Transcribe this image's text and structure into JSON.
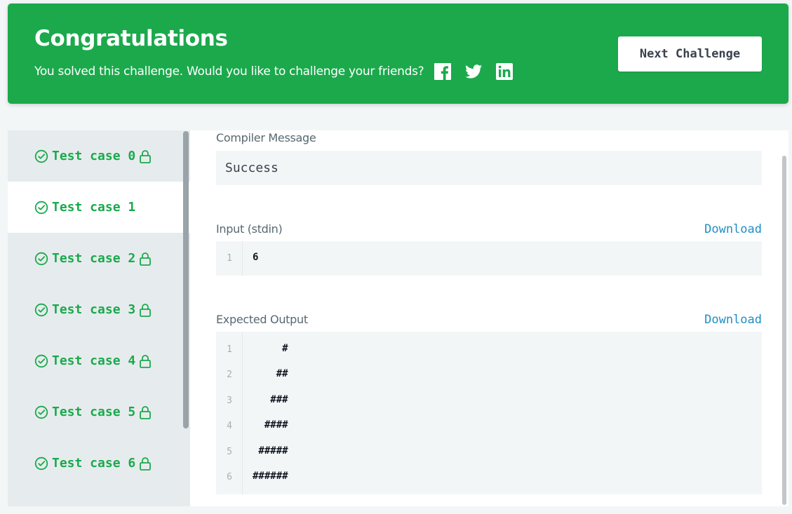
{
  "banner": {
    "title": "Congratulations",
    "message": "You solved this challenge. Would you like to challenge your friends?",
    "social_icons": [
      "facebook-icon",
      "twitter-icon",
      "linkedin-icon"
    ],
    "next_button": "Next Challenge",
    "color": "#1ba94c"
  },
  "sidebar": {
    "test_cases": [
      {
        "label": "Test case 0",
        "locked": true
      },
      {
        "label": "Test case 1",
        "locked": false
      },
      {
        "label": "Test case 2",
        "locked": true
      },
      {
        "label": "Test case 3",
        "locked": true
      },
      {
        "label": "Test case 4",
        "locked": true
      },
      {
        "label": "Test case 5",
        "locked": true
      },
      {
        "label": "Test case 6",
        "locked": true
      }
    ],
    "selected_index": 1
  },
  "compiler": {
    "label": "Compiler Message",
    "message": "Success"
  },
  "input": {
    "label": "Input (stdin)",
    "download": "Download",
    "line_numbers": [
      "1"
    ],
    "lines": [
      "6"
    ]
  },
  "expected": {
    "label": "Expected Output",
    "download": "Download",
    "line_numbers": [
      "1",
      "2",
      "3",
      "4",
      "5",
      "6"
    ],
    "lines": [
      "     #",
      "    ##",
      "   ###",
      "  ####",
      " #####",
      "######"
    ]
  }
}
